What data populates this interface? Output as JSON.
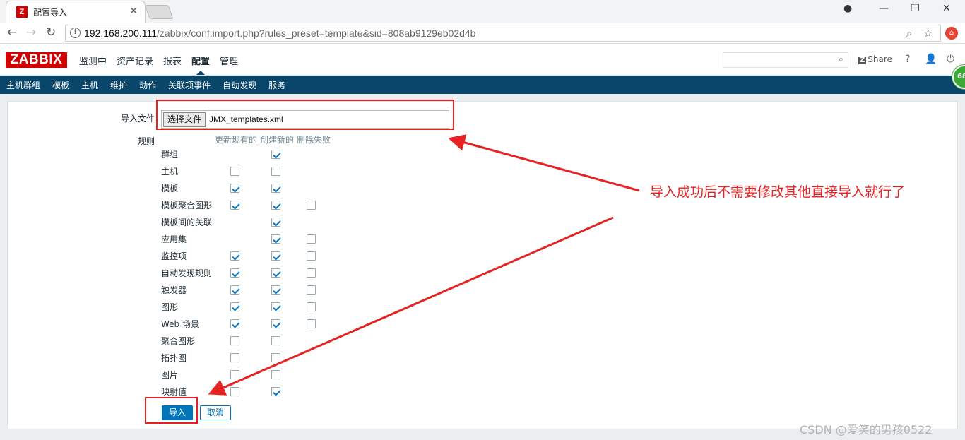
{
  "browser": {
    "tab_title": "配置导入",
    "tab_favicon": "Z",
    "url_host": "192.168.200.111",
    "url_path": "/zabbix/conf.import.php?rules_preset=template&sid=808ab9129eb02d4b"
  },
  "header": {
    "logo": "ZABBIX",
    "menu": [
      "监测中",
      "资产记录",
      "报表",
      "配置",
      "管理"
    ],
    "active_menu": "配置",
    "share_label": "Share",
    "share_badge": "Z",
    "help": "?"
  },
  "submenu": [
    "主机群组",
    "模板",
    "主机",
    "维护",
    "动作",
    "关联项事件",
    "自动发现",
    "服务"
  ],
  "status_badge": "68",
  "form": {
    "file_label": "导入文件",
    "file_button": "选择文件",
    "file_name": "JMX_templates.xml",
    "rules_label": "规则",
    "col_update": "更新现有的",
    "col_create": "创建新的",
    "col_delete": "删除失败",
    "rules": [
      {
        "name": "群组",
        "update": null,
        "create": true,
        "delete": null
      },
      {
        "name": "主机",
        "update": false,
        "create": false,
        "delete": null
      },
      {
        "name": "模板",
        "update": true,
        "create": true,
        "delete": null
      },
      {
        "name": "模板聚合图形",
        "update": true,
        "create": true,
        "delete": false
      },
      {
        "name": "模板间的关联",
        "update": null,
        "create": true,
        "delete": null
      },
      {
        "name": "应用集",
        "update": null,
        "create": true,
        "delete": false
      },
      {
        "name": "监控项",
        "update": true,
        "create": true,
        "delete": false
      },
      {
        "name": "自动发现规则",
        "update": true,
        "create": true,
        "delete": false
      },
      {
        "name": "触发器",
        "update": true,
        "create": true,
        "delete": false
      },
      {
        "name": "图形",
        "update": true,
        "create": true,
        "delete": false
      },
      {
        "name": "Web 场景",
        "update": true,
        "create": true,
        "delete": false
      },
      {
        "name": "聚合图形",
        "update": false,
        "create": false,
        "delete": null
      },
      {
        "name": "拓扑图",
        "update": false,
        "create": false,
        "delete": null
      },
      {
        "name": "图片",
        "update": false,
        "create": false,
        "delete": null
      },
      {
        "name": "映射值",
        "update": false,
        "create": true,
        "delete": null
      }
    ],
    "import_button": "导入",
    "cancel_button": "取消"
  },
  "annotation": {
    "note": "导入成功后不需要修改其他直接导入就行了",
    "color": "#e62222"
  },
  "watermark": "CSDN @爱笑的男孩0522",
  "colors": {
    "brand": "#d40000",
    "nav": "#0a466a",
    "accent": "#0275b8"
  }
}
